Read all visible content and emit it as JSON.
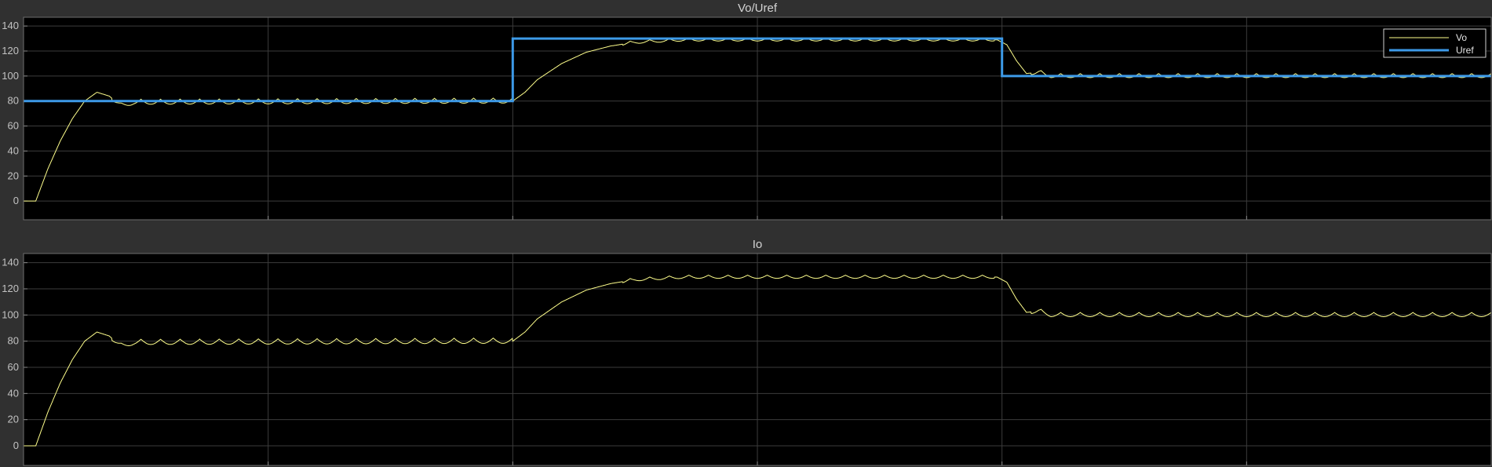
{
  "chart_data": [
    {
      "type": "line",
      "title": "Vo/Uref",
      "xlabel": "",
      "ylabel": "",
      "xlim": [
        0,
        6
      ],
      "ylim": [
        -15,
        147
      ],
      "yticks": [
        0,
        20,
        40,
        60,
        80,
        100,
        120,
        140
      ],
      "xgrid": [
        1,
        2,
        3,
        4,
        5
      ],
      "grid": true,
      "legend": {
        "placement": "top-right",
        "entries": [
          "Vo",
          "Uref"
        ]
      },
      "series": [
        {
          "name": "Vo",
          "color": "#ffff8c",
          "kind": "ripple-response",
          "x": [
            0,
            0.05,
            0.1,
            0.15,
            0.2,
            0.25,
            0.3,
            0.35,
            0.4,
            0.45,
            2.0,
            2.05,
            2.1,
            2.2,
            2.3,
            2.4,
            2.5,
            2.6,
            2.7,
            3.98,
            4.02,
            4.06,
            4.1,
            4.15,
            4.2,
            6.0
          ],
          "y": [
            0,
            0,
            26,
            48,
            66,
            80,
            87,
            84,
            76,
            79,
            80,
            87,
            97,
            110,
            119,
            124,
            127,
            128,
            129,
            129,
            125,
            112,
            102,
            103,
            100,
            100
          ]
        },
        {
          "name": "Uref",
          "color": "#3d9ae8",
          "kind": "step",
          "x": [
            0,
            2.0,
            2.0,
            4.0,
            4.0,
            6.0
          ],
          "y": [
            80,
            80,
            130,
            130,
            100,
            100
          ]
        }
      ]
    },
    {
      "type": "line",
      "title": "Io",
      "xlabel": "",
      "ylabel": "",
      "xlim": [
        0,
        6
      ],
      "ylim": [
        -15,
        147
      ],
      "yticks": [
        0,
        20,
        40,
        60,
        80,
        100,
        120,
        140
      ],
      "xgrid": [
        1,
        2,
        3,
        4,
        5
      ],
      "grid": true,
      "series": [
        {
          "name": "Io",
          "color": "#ffff8c",
          "kind": "ripple-response",
          "x": [
            0,
            0.05,
            0.1,
            0.15,
            0.2,
            0.25,
            0.3,
            0.35,
            0.4,
            0.45,
            2.0,
            2.05,
            2.1,
            2.2,
            2.3,
            2.4,
            2.5,
            2.6,
            2.7,
            3.98,
            4.02,
            4.06,
            4.1,
            4.15,
            4.2,
            6.0
          ],
          "y": [
            0,
            0,
            26,
            48,
            66,
            80,
            87,
            84,
            76,
            79,
            80,
            87,
            97,
            110,
            119,
            124,
            127,
            128,
            129,
            129,
            125,
            112,
            102,
            103,
            100,
            100
          ]
        }
      ]
    }
  ],
  "colors": {
    "figure_bg": "#303030",
    "axes_bg": "#000000",
    "grid": "#3c3c3c",
    "frame": "#6e6e6e"
  }
}
